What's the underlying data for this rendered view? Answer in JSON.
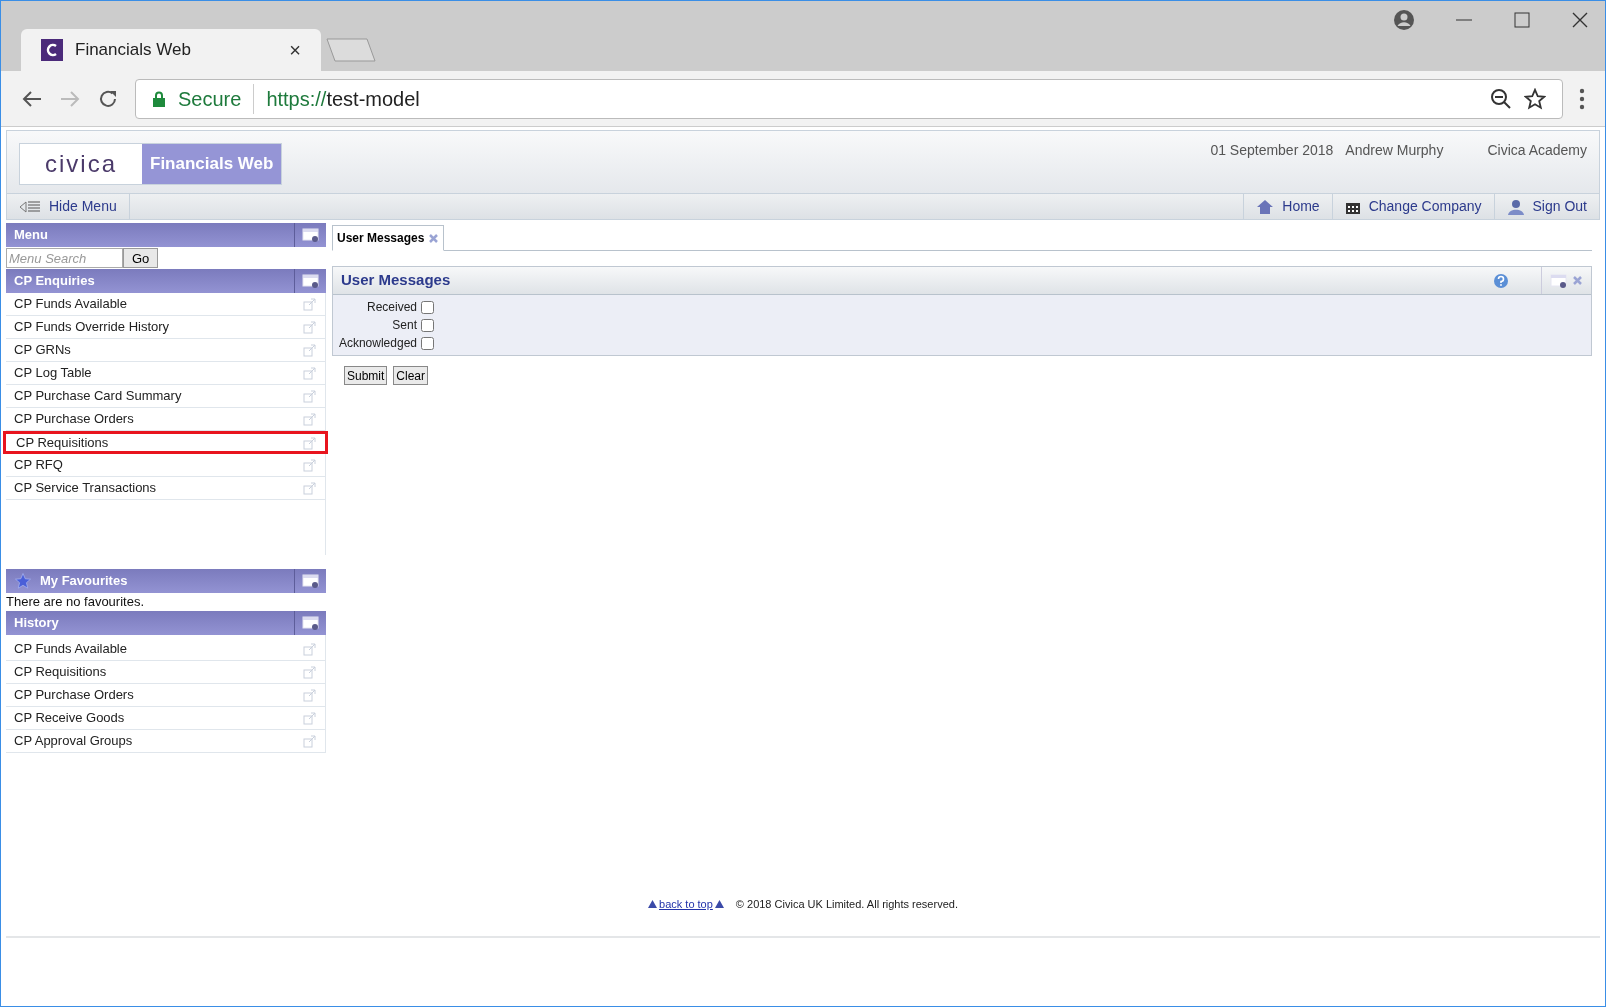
{
  "browser": {
    "tab_title": "Financials Web",
    "tab_close": "×",
    "secure_label": "Secure",
    "url_scheme": "https://",
    "url_host": "test-model"
  },
  "header": {
    "logo": "civica",
    "product": "Financials Web",
    "date": "01 September 2018",
    "user": "Andrew Murphy",
    "company": "Civica Academy"
  },
  "toolbar": {
    "hide_menu": "Hide Menu",
    "links": [
      {
        "label": "Home",
        "kind": "home"
      },
      {
        "label": "Change Company",
        "kind": "company"
      },
      {
        "label": "Sign Out",
        "kind": "signout"
      }
    ]
  },
  "sidebar": {
    "menu_title": "Menu",
    "search_placeholder": "Menu Search",
    "go": "Go",
    "enquiries": {
      "title": "CP Enquiries",
      "items": [
        {
          "label": "CP Funds Available",
          "highlighted": false
        },
        {
          "label": "CP Funds Override History",
          "highlighted": false
        },
        {
          "label": "CP GRNs",
          "highlighted": false
        },
        {
          "label": "CP Log Table",
          "highlighted": false
        },
        {
          "label": "CP Purchase Card Summary",
          "highlighted": false
        },
        {
          "label": "CP Purchase Orders",
          "highlighted": false
        },
        {
          "label": "CP Requisitions",
          "highlighted": true
        },
        {
          "label": "CP RFQ",
          "highlighted": false
        },
        {
          "label": "CP Service Transactions",
          "highlighted": false
        }
      ]
    },
    "favourites": {
      "title": "My Favourites",
      "empty": "There are no favourites."
    },
    "history": {
      "title": "History",
      "items": [
        "CP Funds Available",
        "CP Requisitions",
        "CP Purchase Orders",
        "CP Receive Goods",
        "CP Approval Groups"
      ]
    }
  },
  "content": {
    "tabs": [
      {
        "label": "User Messages",
        "selected": true
      }
    ],
    "panel_title": "User Messages",
    "filters": [
      {
        "label": "Received",
        "checked": false
      },
      {
        "label": "Sent",
        "checked": false
      },
      {
        "label": "Acknowledged",
        "checked": false
      }
    ],
    "buttons": [
      "Submit",
      "Clear"
    ]
  },
  "footer": {
    "back_to_top": "back to top",
    "copyright": "© 2018 Civica UK Limited. All rights reserved."
  }
}
